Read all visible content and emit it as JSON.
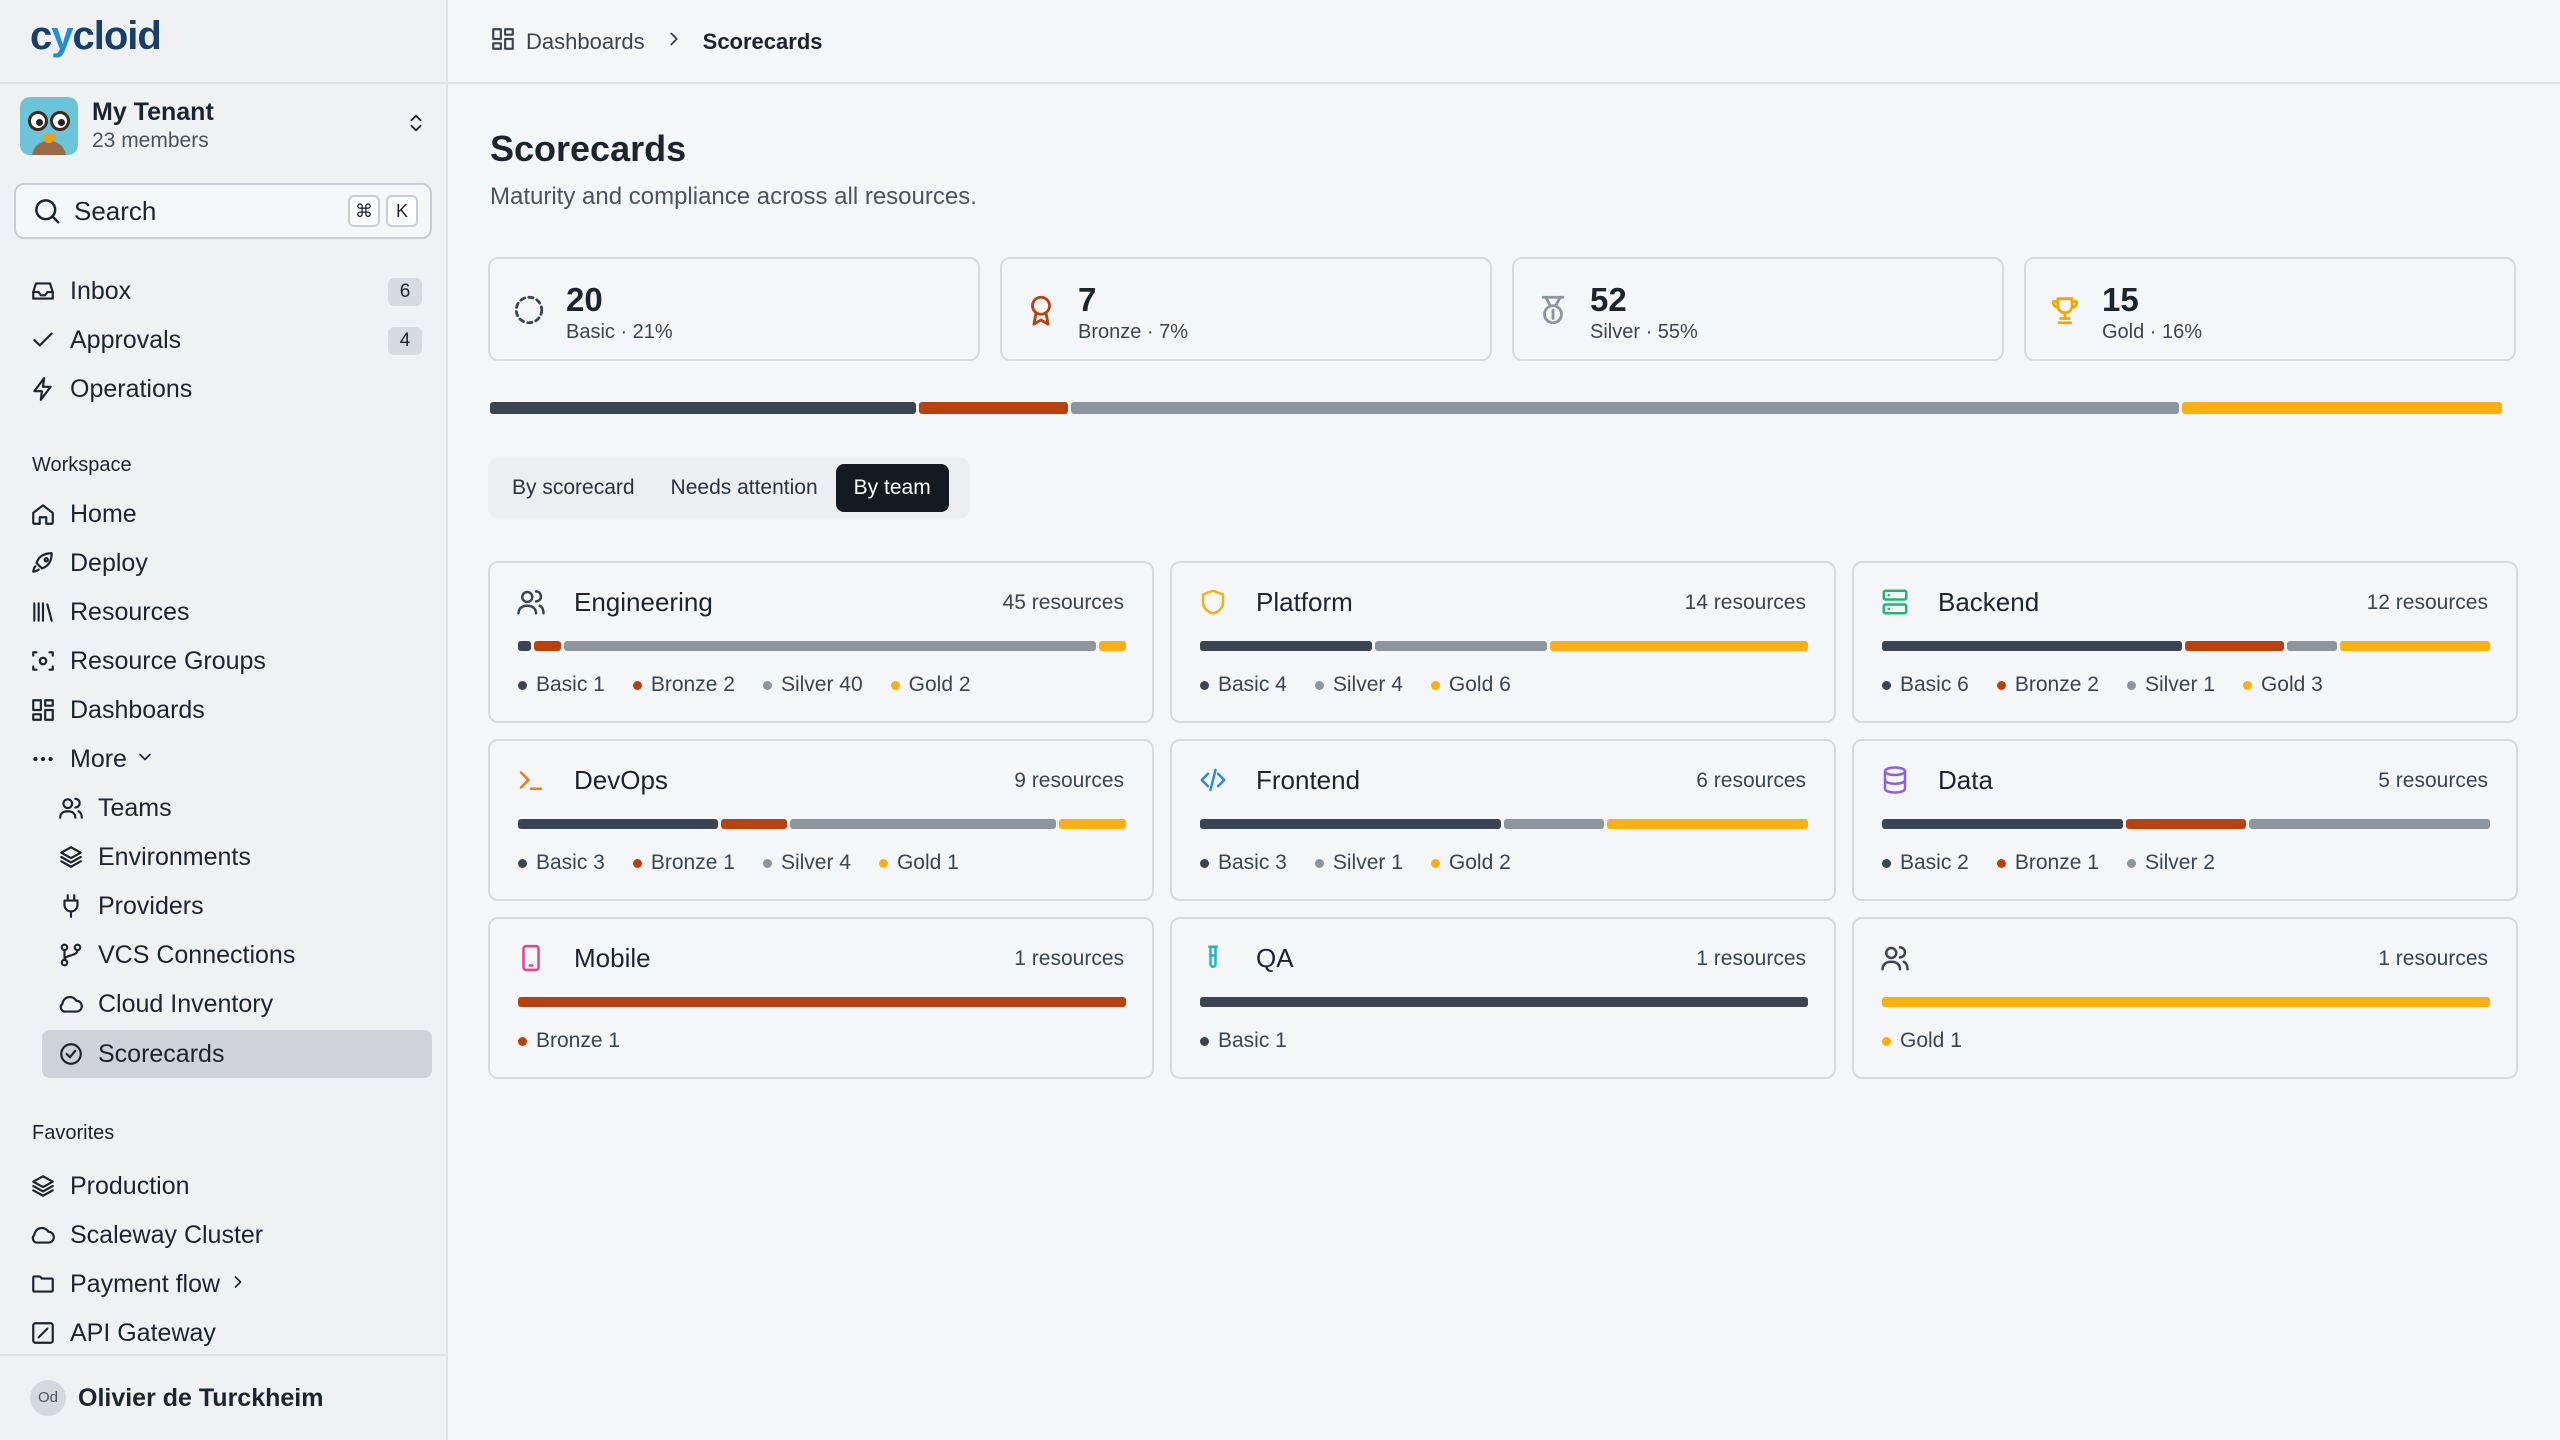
{
  "colors": {
    "basic": "#3b4452",
    "bronze": "#b8410f",
    "silver": "#8e959e",
    "gold": "#f8b012"
  },
  "sidebar": {
    "logo": "cycloid",
    "tenant": {
      "name": "My Tenant",
      "members": "23 members"
    },
    "search": {
      "label": "Search",
      "kbd": [
        "⌘",
        "K"
      ]
    },
    "primary": [
      {
        "label": "Inbox",
        "badge": "6",
        "icon": "inbox-icon"
      },
      {
        "label": "Approvals",
        "badge": "4",
        "icon": "check-icon"
      },
      {
        "label": "Operations",
        "icon": "bolt-icon"
      }
    ],
    "workspace_label": "Workspace",
    "workspace": [
      {
        "label": "Home",
        "icon": "home-icon"
      },
      {
        "label": "Deploy",
        "icon": "rocket-icon"
      },
      {
        "label": "Resources",
        "icon": "library-icon"
      },
      {
        "label": "Resource Groups",
        "icon": "scan-icon"
      },
      {
        "label": "Dashboards",
        "icon": "grid-icon"
      },
      {
        "label": "More",
        "icon": "dots-icon"
      }
    ],
    "more": [
      {
        "label": "Teams",
        "icon": "users-icon"
      },
      {
        "label": "Environments",
        "icon": "layers-icon"
      },
      {
        "label": "Providers",
        "icon": "plug-icon"
      },
      {
        "label": "VCS Connections",
        "icon": "git-branch-icon"
      },
      {
        "label": "Cloud Inventory",
        "icon": "cloud-icon"
      },
      {
        "label": "Scorecards",
        "icon": "badge-check-icon",
        "active": true
      }
    ],
    "favorites_label": "Favorites",
    "favorites": [
      {
        "label": "Production",
        "icon": "layers-icon"
      },
      {
        "label": "Scaleway Cluster",
        "icon": "cloud-icon"
      },
      {
        "label": "Payment flow",
        "icon": "folder-icon"
      },
      {
        "label": "API Gateway",
        "icon": "square-pen-icon"
      }
    ],
    "user": {
      "initials": "Od",
      "name": "Olivier de Turckheim"
    }
  },
  "breadcrumb": {
    "parent": "Dashboards",
    "current": "Scorecards"
  },
  "page": {
    "title": "Scorecards",
    "subtitle": "Maturity and compliance across all resources."
  },
  "stats": [
    {
      "value": "20",
      "label": "Basic · 21%",
      "icon": "dashed-circle-icon",
      "level": "basic"
    },
    {
      "value": "7",
      "label": "Bronze · 7%",
      "icon": "ribbon-icon",
      "level": "bronze"
    },
    {
      "value": "52",
      "label": "Silver · 55%",
      "icon": "medal-icon",
      "level": "silver"
    },
    {
      "value": "15",
      "label": "Gold · 16%",
      "icon": "trophy-icon",
      "level": "gold"
    }
  ],
  "overall_distribution": {
    "basic": 20,
    "bronze": 7,
    "silver": 52,
    "gold": 15
  },
  "tabs": [
    {
      "label": "By scorecard"
    },
    {
      "label": "Needs attention"
    },
    {
      "label": "By team",
      "active": true
    }
  ],
  "teams": [
    {
      "name": "Engineering",
      "count_label": "45 resources",
      "icon": "users-icon",
      "icon_color": "#3b4552",
      "levels": [
        {
          "level": "basic",
          "label": "Basic 1",
          "n": 1
        },
        {
          "level": "bronze",
          "label": "Bronze 2",
          "n": 2
        },
        {
          "level": "silver",
          "label": "Silver 40",
          "n": 40
        },
        {
          "level": "gold",
          "label": "Gold 2",
          "n": 2
        }
      ]
    },
    {
      "name": "Platform",
      "count_label": "14 resources",
      "icon": "shield-icon",
      "icon_color": "#f0b020",
      "levels": [
        {
          "level": "basic",
          "label": "Basic 4",
          "n": 4
        },
        {
          "level": "silver",
          "label": "Silver 4",
          "n": 4
        },
        {
          "level": "gold",
          "label": "Gold 6",
          "n": 6
        }
      ]
    },
    {
      "name": "Backend",
      "count_label": "12 resources",
      "icon": "server-icon",
      "icon_color": "#22b573",
      "levels": [
        {
          "level": "basic",
          "label": "Basic 6",
          "n": 6
        },
        {
          "level": "bronze",
          "label": "Bronze 2",
          "n": 2
        },
        {
          "level": "silver",
          "label": "Silver 1",
          "n": 1
        },
        {
          "level": "gold",
          "label": "Gold 3",
          "n": 3
        }
      ]
    },
    {
      "name": "DevOps",
      "count_label": "9 resources",
      "icon": "terminal-icon",
      "icon_color": "#f07820",
      "levels": [
        {
          "level": "basic",
          "label": "Basic 3",
          "n": 3
        },
        {
          "level": "bronze",
          "label": "Bronze 1",
          "n": 1
        },
        {
          "level": "silver",
          "label": "Silver 4",
          "n": 4
        },
        {
          "level": "gold",
          "label": "Gold 1",
          "n": 1
        }
      ]
    },
    {
      "name": "Frontend",
      "count_label": "6 resources",
      "icon": "code-icon",
      "icon_color": "#2e8ae0",
      "levels": [
        {
          "level": "basic",
          "label": "Basic 3",
          "n": 3
        },
        {
          "level": "silver",
          "label": "Silver 1",
          "n": 1
        },
        {
          "level": "gold",
          "label": "Gold 2",
          "n": 2
        }
      ]
    },
    {
      "name": "Data",
      "count_label": "5 resources",
      "icon": "database-icon",
      "icon_color": "#8a62e0",
      "levels": [
        {
          "level": "basic",
          "label": "Basic 2",
          "n": 2
        },
        {
          "level": "bronze",
          "label": "Bronze 1",
          "n": 1
        },
        {
          "level": "silver",
          "label": "Silver 2",
          "n": 2
        }
      ]
    },
    {
      "name": "Mobile",
      "count_label": "1 resources",
      "icon": "smartphone-icon",
      "icon_color": "#e8408a",
      "levels": [
        {
          "level": "bronze",
          "label": "Bronze 1",
          "n": 1
        }
      ]
    },
    {
      "name": "QA",
      "count_label": "1 resources",
      "icon": "test-tube-icon",
      "icon_color": "#18b8c8",
      "levels": [
        {
          "level": "basic",
          "label": "Basic 1",
          "n": 1
        }
      ]
    },
    {
      "name": "",
      "count_label": "1 resources",
      "icon": "users-icon",
      "icon_color": "#3b4552",
      "levels": [
        {
          "level": "gold",
          "label": "Gold 1",
          "n": 1
        }
      ]
    }
  ]
}
